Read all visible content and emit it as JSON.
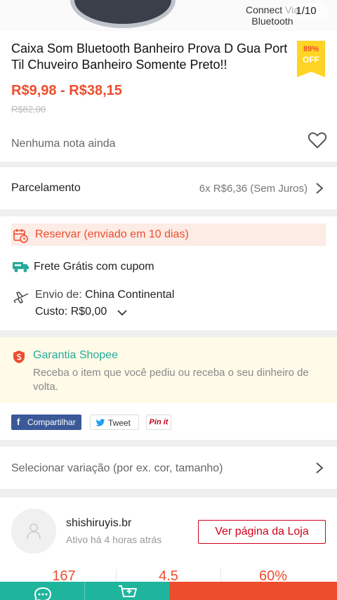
{
  "image_overlay": {
    "caption": "Connect Via Bluetooth",
    "counter": "1/10"
  },
  "product": {
    "title": "Caixa Som Bluetooth Banheiro Prova D Gua Port Til Chuveiro Banheiro Somente Preto!!",
    "discount_percent": "89%",
    "discount_label": "OFF",
    "price_range": "R$9,98 - R$38,15",
    "old_price": "R$82,00",
    "rating_text": "Nenhuma nota ainda"
  },
  "installment": {
    "label": "Parcelamento",
    "value": "6x R$6,36 (Sem Juros)"
  },
  "shipping": {
    "reserve_text": "Reservar (enviado em 10 dias)",
    "free_shipping_text": "Frete Grátis com cupom",
    "ship_from_label": "Envio de:",
    "ship_from_value": "China Continental",
    "cost_label": "Custo:",
    "cost_value": "R$0,00"
  },
  "guarantee": {
    "title": "Garantia Shopee",
    "description": "Receba o item que você pediu ou receba o seu dinheiro de volta."
  },
  "share": {
    "facebook": "Compartilhar",
    "twitter": "Tweet",
    "pinterest": "Pin it"
  },
  "variation": {
    "label": "Selecionar variação (por ex. cor, tamanho)"
  },
  "shop": {
    "name": "shishiruyis.br",
    "active": "Ativo há 4 horas atrás",
    "view_button": "Ver página da Loja",
    "stats": [
      "167",
      "4.5",
      "60%"
    ]
  },
  "colors": {
    "primary": "#ee4d2d",
    "teal": "#26aa99",
    "bottom_green": "#1fb59d",
    "badge_yellow": "#ffd424"
  },
  "icons": {
    "heart": "heart-icon",
    "calendar": "calendar-clock-icon",
    "truck": "free-shipping-truck-icon",
    "plane": "plane-icon",
    "shield": "shield-icon",
    "chat": "chat-icon",
    "cart": "add-to-cart-icon"
  }
}
